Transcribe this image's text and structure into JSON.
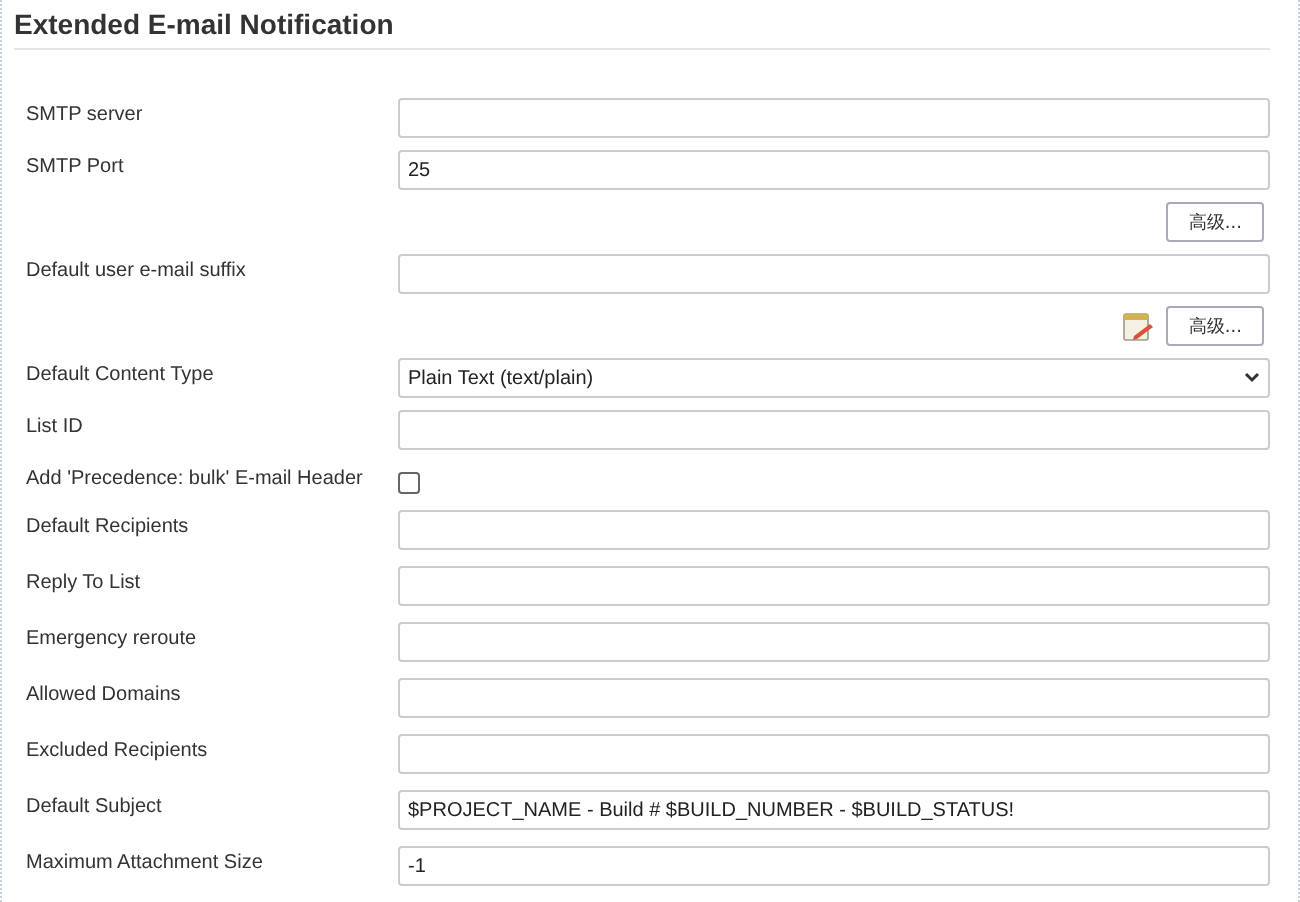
{
  "section": {
    "title": "Extended E-mail Notification"
  },
  "rows": [
    {
      "kind": "text",
      "label": "SMTP server",
      "value": ""
    },
    {
      "kind": "text",
      "label": "SMTP Port",
      "value": "25"
    },
    {
      "kind": "actions",
      "button": "高级...",
      "edit_icon": false
    },
    {
      "kind": "text",
      "label": "Default user e-mail suffix",
      "value": ""
    },
    {
      "kind": "actions",
      "button": "高级...",
      "edit_icon": true
    },
    {
      "kind": "select",
      "label": "Default Content Type",
      "value": "Plain Text (text/plain)"
    },
    {
      "kind": "text",
      "label": "List ID",
      "value": ""
    },
    {
      "kind": "checkbox",
      "label": "Add 'Precedence: bulk' E-mail Header",
      "checked": false
    },
    {
      "kind": "text",
      "label": "Default Recipients",
      "value": ""
    },
    {
      "kind": "text",
      "label": "Reply To List",
      "value": ""
    },
    {
      "kind": "text",
      "label": "Emergency reroute",
      "value": ""
    },
    {
      "kind": "text",
      "label": "Allowed Domains",
      "value": ""
    },
    {
      "kind": "text",
      "label": "Excluded Recipients",
      "value": ""
    },
    {
      "kind": "text",
      "label": "Default Subject",
      "value": "$PROJECT_NAME - Build # $BUILD_NUMBER - $BUILD_STATUS!"
    },
    {
      "kind": "text",
      "label": "Maximum Attachment Size",
      "value": "-1"
    }
  ]
}
